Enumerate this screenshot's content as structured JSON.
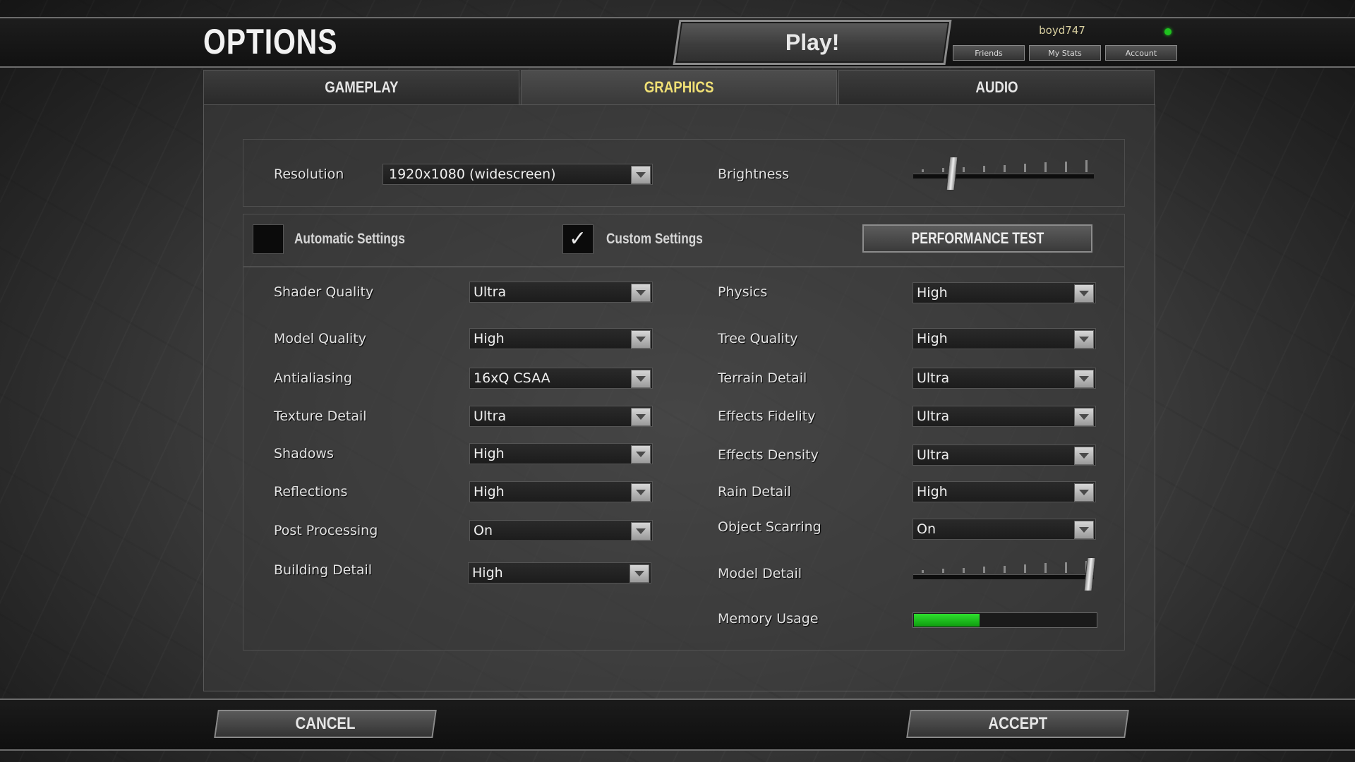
{
  "header": {
    "title": "OPTIONS",
    "play_label": "Play!"
  },
  "user": {
    "username": "boyd747",
    "online_status_color": "#1fc21f",
    "buttons": {
      "friends": "Friends",
      "my_stats": "My Stats",
      "account": "Account"
    }
  },
  "tabs": [
    {
      "label": "GAMEPLAY",
      "active": false
    },
    {
      "label": "GRAPHICS",
      "active": true
    },
    {
      "label": "AUDIO",
      "active": false
    }
  ],
  "display": {
    "resolution_label": "Resolution",
    "resolution_value": "1920x1080 (widescreen)",
    "brightness_label": "Brightness",
    "brightness_level": 0.2
  },
  "settings_mode": {
    "automatic_label": "Automatic Settings",
    "automatic_checked": false,
    "custom_label": "Custom Settings",
    "custom_checked": true,
    "performance_test_label": "PERFORMANCE TEST"
  },
  "left_settings": [
    {
      "label": "Shader Quality",
      "value": "Ultra"
    },
    {
      "label": "Model Quality",
      "value": "High"
    },
    {
      "label": "Antialiasing",
      "value": "16xQ CSAA"
    },
    {
      "label": "Texture Detail",
      "value": "Ultra"
    },
    {
      "label": "Shadows",
      "value": "High"
    },
    {
      "label": "Reflections",
      "value": "High"
    },
    {
      "label": "Post Processing",
      "value": "On"
    },
    {
      "label": "Building Detail",
      "value": "High"
    }
  ],
  "right_settings": [
    {
      "label": "Physics",
      "value": "High"
    },
    {
      "label": "Tree Quality",
      "value": "High"
    },
    {
      "label": "Terrain Detail",
      "value": "Ultra"
    },
    {
      "label": "Effects Fidelity",
      "value": "Ultra"
    },
    {
      "label": "Effects Density",
      "value": "Ultra"
    },
    {
      "label": "Rain Detail",
      "value": "High"
    },
    {
      "label": "Object Scarring",
      "value": "On"
    }
  ],
  "model_detail": {
    "label": "Model Detail",
    "level": 1.0
  },
  "memory_usage": {
    "label": "Memory Usage",
    "fraction": 0.36,
    "color": "#2ee02e"
  },
  "footer": {
    "cancel_label": "CANCEL",
    "accept_label": "ACCEPT"
  }
}
